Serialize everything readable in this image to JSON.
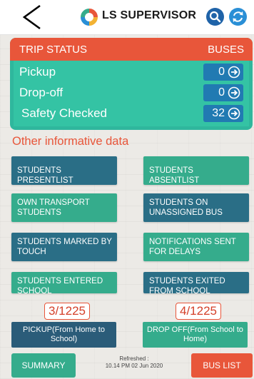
{
  "header": {
    "title": "LS SUPERVISOR",
    "back_icon": "chevron-left-icon",
    "search_icon": "search-icon",
    "refresh_icon": "refresh-icon"
  },
  "trip_status": {
    "heading": "TRIP STATUS",
    "buses_label": "BUSES",
    "rows": [
      {
        "label": "Pickup",
        "value": "0"
      },
      {
        "label": "Drop-off",
        "value": "0"
      },
      {
        "label": "Safety Checked",
        "value": "32"
      }
    ]
  },
  "section_title": "Other informative data",
  "tiles": [
    {
      "label": "STUDENTS PRESENTLIST"
    },
    {
      "label": "STUDENTS ABSENTLIST"
    },
    {
      "label": "OWN TRANSPORT STUDENTS"
    },
    {
      "label": "STUDENTS ON UNASSIGNED BUS"
    },
    {
      "label": "STUDENTS MARKED BY TOUCH"
    },
    {
      "label": "NOTIFICATIONS SENT FOR DELAYS"
    },
    {
      "label": "STUDENTS ENTERED SCHOOL"
    },
    {
      "label": "STUDENTS EXITED FROM SCHOOL"
    }
  ],
  "counts": {
    "pickup": {
      "count": "3/1225",
      "label": "PICKUP(From Home to School)"
    },
    "dropoff": {
      "count": "4/1225",
      "label": "DROP OFF(From School to Home)"
    }
  },
  "bottom": {
    "summary_label": "SUMMARY",
    "refreshed_label": "Refreshed :",
    "refreshed_time": "10.14 PM 02 Jun 2020",
    "bus_list_label": "BUS LIST"
  },
  "colors": {
    "accent_orange": "#e8563a",
    "teal": "#35ac8c",
    "dark_teal": "#2a6e86",
    "value_blue": "#217ab2"
  }
}
